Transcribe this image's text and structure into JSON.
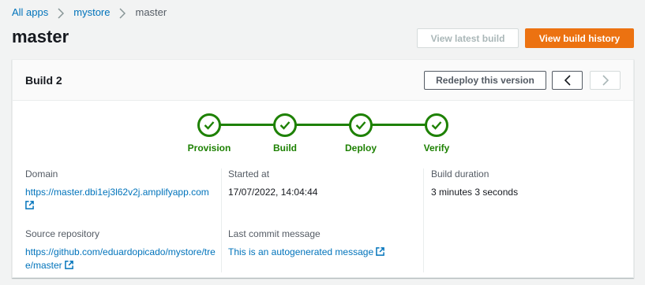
{
  "breadcrumb": {
    "items": [
      "All apps",
      "mystore"
    ],
    "current": "master"
  },
  "page": {
    "title": "master"
  },
  "actions": {
    "view_latest_build": "View latest build",
    "view_build_history": "View build history"
  },
  "card": {
    "title": "Build 2",
    "redeploy_label": "Redeploy this version",
    "steps": [
      "Provision",
      "Build",
      "Deploy",
      "Verify"
    ],
    "fields": {
      "domain": {
        "label": "Domain",
        "value": "https://master.dbi1ej3l62v2j.amplifyapp.com"
      },
      "source_repository": {
        "label": "Source repository",
        "value": "https://github.com/eduardopicado/mystore/tree/master"
      },
      "started_at": {
        "label": "Started at",
        "value": "17/07/2022, 14:04:44"
      },
      "last_commit_message": {
        "label": "Last commit message",
        "value": "This is an autogenerated message"
      },
      "build_duration": {
        "label": "Build duration",
        "value": "3 minutes 3 seconds"
      }
    }
  },
  "icons": [
    "chevron-right-icon",
    "chevron-left-icon",
    "check-icon",
    "external-link-icon"
  ],
  "colors": {
    "link": "#0073bb",
    "primary": "#ec7211",
    "success": "#1d8102",
    "text": "#16191f",
    "muted": "#545b64"
  }
}
